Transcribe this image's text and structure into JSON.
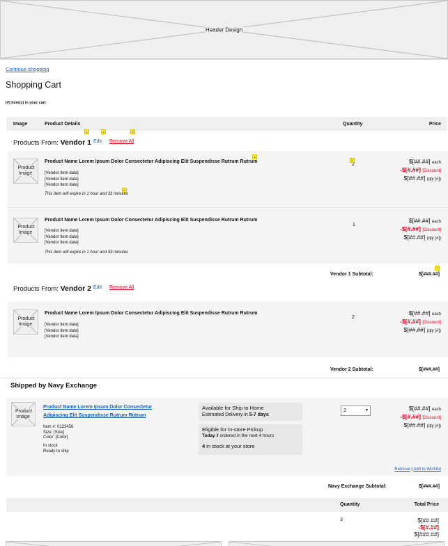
{
  "header": {
    "placeholder_label": "Header Design"
  },
  "nav": {
    "continue_shopping": "Continue shopping"
  },
  "page": {
    "title": "Shopping Cart",
    "item_count": "[#] item(s) in your cart"
  },
  "table_header": {
    "image": "Image",
    "details": "Product Details",
    "quantity": "Quantity",
    "price": "Price"
  },
  "markers": [
    "1",
    "2",
    "3",
    "4",
    "5",
    "6",
    "7"
  ],
  "vendor1": {
    "from_label": "Products From:",
    "name": "Vendor 1",
    "edit": "Edit",
    "remove_all": "Remove All",
    "items": [
      {
        "image_label": "Product Image",
        "name": "Product Name Lorem Ipsum Dolor Consectetur Adipiscing Elit Suspendisse Rutrum Rutrum",
        "data": [
          "[Vendor item data]",
          "[Vendor item data]",
          "[Vendor item data]"
        ],
        "expire": "This item will expire in 1 hour and 33 minutes",
        "qty": "2",
        "price_each": "$[##.##]",
        "each_label": "each",
        "discount": "-$[#.##]",
        "discount_label": "[Discount]",
        "price_total": "$[##.##]",
        "qty_label": "(qty [#])"
      },
      {
        "image_label": "Product Image",
        "name": "Product Name Lorem Ipsum Dolor Consectetur Adipiscing Elit Suspendisse Rutrum Rutrum",
        "data": [
          "[Vendor item data]",
          "[Vendor item data]",
          "[Vendor item data]"
        ],
        "expire": "This item will expire in 1 hour and 33 minutes",
        "qty": "1",
        "price_each": "$[##.##]",
        "each_label": "each",
        "discount": "-$[#.##]",
        "discount_label": "[Discount]",
        "price_total": "$[##.##]",
        "qty_label": "(qty [#])"
      }
    ],
    "subtotal_label": "Vendor 1 Subtotal:",
    "subtotal_value": "$[###.##]"
  },
  "vendor2": {
    "from_label": "Products From:",
    "name": "Vendor 2",
    "edit": "Edit",
    "remove_all": "Remove All",
    "item": {
      "image_label": "Product Image",
      "name": "Product Name Lorem Ipsum Dolor Consectetur Adipiscing Elit Suspendisse Rutrum Rutrum",
      "data": [
        "[Vendor item data]",
        "[Vendor item data]",
        "[Vendor item data]"
      ],
      "qty": "2",
      "price_each": "$[##.##]",
      "each_label": "each",
      "discount": "-$[#.##]",
      "discount_label": "[Discount]",
      "price_total": "$[##.##]",
      "qty_label": "(qty [#])"
    },
    "subtotal_label": "Vendor 2 Subtotal:",
    "subtotal_value": "$[###.##]"
  },
  "navy": {
    "heading": "Shipped by Navy Exchange",
    "item": {
      "image_label": "Product Image",
      "name_line1": "Product Name Lorem Ipsum Dolor Consectetur",
      "name_line2": "Adipiscing Elit Suspendisse Rutrum Rutrum",
      "item_no": "Item #: 0123456",
      "size": "Size: [Size]",
      "color": "Color: [Color]",
      "stock": "In stock",
      "ready": "Ready to ship",
      "ship_title": "Available for Ship to Home",
      "ship_est": "Estimated Delivery in",
      "ship_days": "5-7 days",
      "pickup_title": "Eligible for In-store Pickup",
      "pickup_today": "Today",
      "pickup_rest": "if ordered in the next 4 hours",
      "store_count": "4",
      "store_rest": "in stock at your store",
      "qty_select": "2",
      "price_each": "$[##.##]",
      "each_label": "each",
      "discount": "-$[#.##]",
      "discount_label": "[Discount]",
      "price_total": "$[##.##]",
      "qty_label": "(qty [#])",
      "remove": "Remove",
      "separator": "|",
      "add_wishlist": "Add to Wishlist"
    },
    "subtotal_label": "Navy Exchange Subtotal:",
    "subtotal_value": "$[###.##]"
  },
  "summary": {
    "qty_header": "Quantity",
    "total_header": "Total Price",
    "qty": "3",
    "line1": "$[##.##]",
    "line2": "-$[#.##]",
    "line3": "$[###.##]"
  }
}
